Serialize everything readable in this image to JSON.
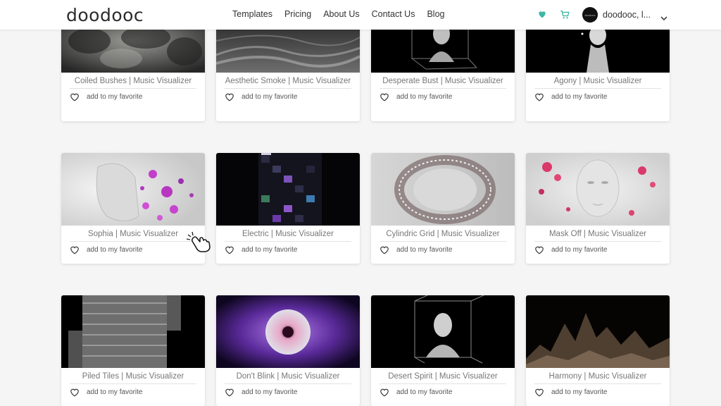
{
  "header": {
    "logo": "doodooc",
    "nav": [
      "Templates",
      "Pricing",
      "About Us",
      "Contact Us",
      "Blog"
    ],
    "user_name": "doodooc, l...",
    "avatar_text": "doodooc"
  },
  "fav_label": "add to my favorite",
  "colors": {
    "accent": "#3fb8a6",
    "text": "#333333",
    "muted": "#777777"
  },
  "cards": [
    {
      "title": "Coiled Bushes | Music Visualizer"
    },
    {
      "title": "Aesthetic Smoke | Music Visualizer"
    },
    {
      "title": "Desperate Bust | Music Visualizer"
    },
    {
      "title": "Agony | Music Visualizer"
    },
    {
      "title": "Sophia | Music Visualizer"
    },
    {
      "title": "Electric | Music Visualizer"
    },
    {
      "title": "Cylindric Grid | Music Visualizer"
    },
    {
      "title": "Mask Off | Music Visualizer"
    },
    {
      "title": "Piled Tiles | Music Visualizer"
    },
    {
      "title": "Don't Blink | Music Visualizer"
    },
    {
      "title": "Desert Spirit | Music Visualizer"
    },
    {
      "title": "Harmony | Music Visualizer"
    }
  ]
}
